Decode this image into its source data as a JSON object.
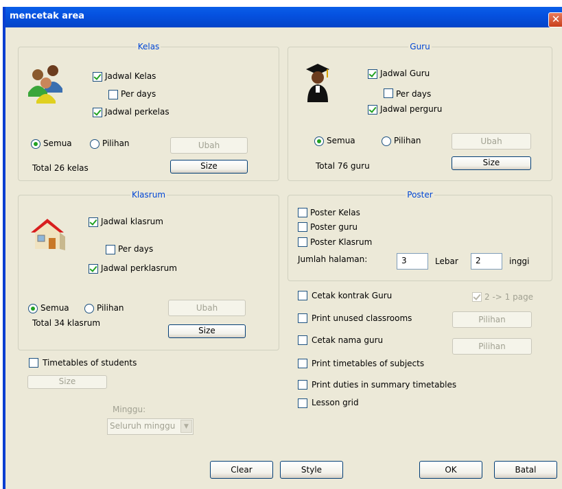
{
  "window": {
    "title": "mencetak area"
  },
  "kelas": {
    "title": "Kelas",
    "jadwal_kelas": "Jadwal Kelas",
    "per_days": "Per days",
    "jadwal_perkelas": "Jadwal perkelas",
    "radio_all": "Semua",
    "radio_choice": "Pilihan",
    "ubah": "Ubah",
    "total": "Total 26 kelas",
    "size": "Size"
  },
  "guru": {
    "title": "Guru",
    "jadwal_guru": "Jadwal Guru",
    "per_days": "Per days",
    "jadwal_perguru": "Jadwal perguru",
    "radio_all": "Semua",
    "radio_choice": "Pilihan",
    "ubah": "Ubah",
    "total": "Total 76 guru",
    "size": "Size"
  },
  "klasrum": {
    "title": "Klasrum",
    "jadwal_klasrum": "Jadwal klasrum",
    "per_days": "Per days",
    "jadwal_perklasrum": "Jadwal perklasrum",
    "radio_all": "Semua",
    "radio_choice": "Pilihan",
    "ubah": "Ubah",
    "total": "Total  34 klasrum",
    "size": "Size"
  },
  "poster": {
    "title": "Poster",
    "kelas": "Poster Kelas",
    "guru": "Poster guru",
    "klasrum": "Poster Klasrum",
    "jumlah_label": "Jumlah halaman:",
    "lebar_value": "3",
    "lebar_label": "Lebar",
    "tinggi_value": "2",
    "tinggi_label": "inggi"
  },
  "students": {
    "label": "Timetables of students",
    "size": "Size",
    "minggu_label": "Minggu:",
    "minggu_value": "Seluruh minggu"
  },
  "options": {
    "cetak_kontrak": "Cetak kontrak Guru",
    "two_to_one": "2 -> 1 page",
    "unused_classrooms": "Print unused classrooms",
    "pilihan_1": "Pilihan",
    "cetak_nama": "Cetak nama guru",
    "pilihan_2": "Pilihan",
    "subjects": "Print timetables of subjects",
    "duties": "Print duties in summary timetables",
    "lesson_grid": "Lesson grid"
  },
  "footer": {
    "clear": "Clear",
    "style": "Style",
    "ok": "OK",
    "batal": "Batal"
  },
  "icons": [
    "users-group-icon",
    "graduate-icon",
    "house-icon",
    "close-icon",
    "chevron-down-icon"
  ],
  "colors": {
    "titlebar": "#0551e0",
    "accent_label": "#0046d5",
    "check": "#21a121",
    "dialog_bg": "#ece9d8"
  }
}
